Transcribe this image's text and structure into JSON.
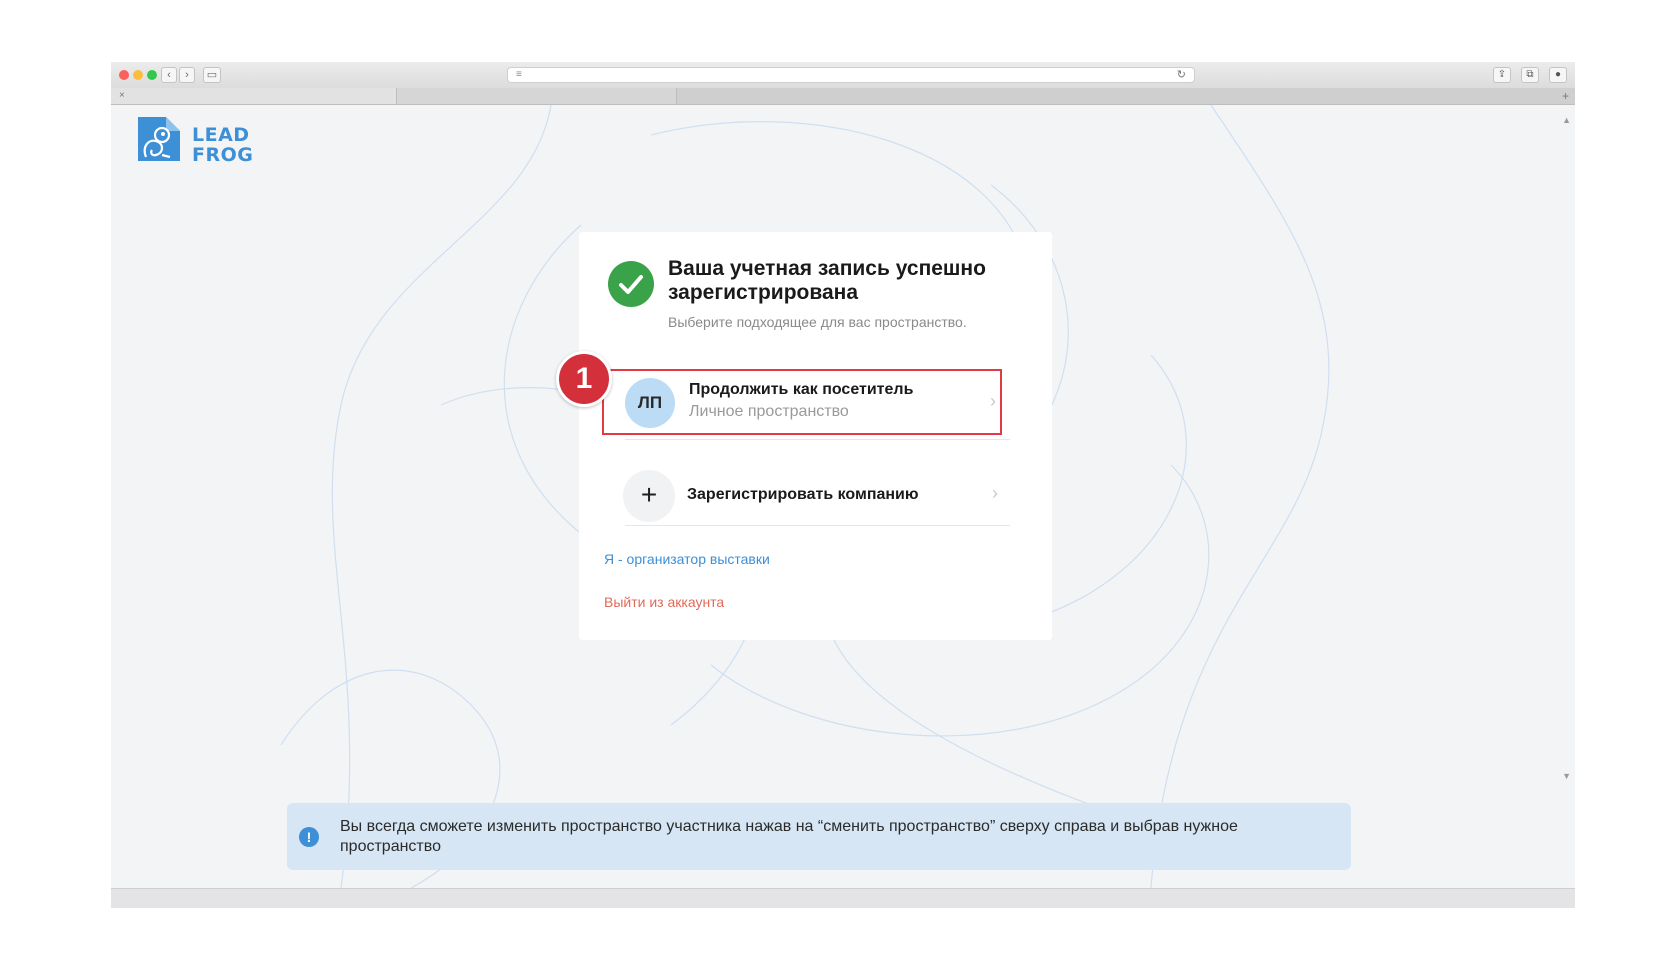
{
  "logo": {
    "line1": "LEAD",
    "line2": "FROG"
  },
  "card": {
    "title": "Ваша учетная запись успешно зарегистрирована",
    "subtitle": "Выберите подходящее для вас пространство.",
    "options": [
      {
        "avatar": "ЛП",
        "title": "Продолжить как посетитель",
        "subtitle": "Личное пространство",
        "highlighted": true
      },
      {
        "icon": "plus-icon",
        "title": "Зарегистрировать компанию",
        "subtitle": ""
      }
    ],
    "organizer_link": "Я - организатор выставки",
    "logout_link": "Выйти из аккаунта"
  },
  "step_badge": "1",
  "notice": {
    "icon": "info-icon",
    "text": "Вы всегда сможете изменить пространство участника нажав на “сменить пространство” сверху справа и выбрав нужное пространство"
  },
  "colors": {
    "brand": "#3d8fd6",
    "success": "#3aa34a",
    "highlight": "#e23a44",
    "logout": "#e06a5a",
    "notice_bg": "#d6e6f4"
  }
}
